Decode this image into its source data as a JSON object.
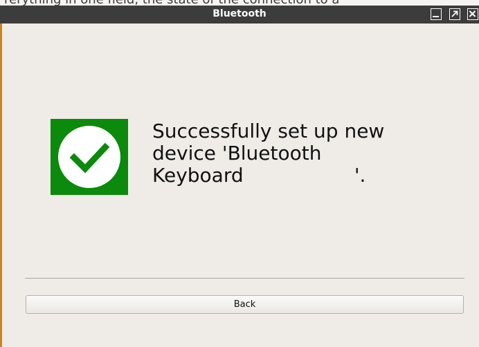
{
  "background_text": "rerything in one field, the state of the connection to a",
  "window": {
    "title": "Bluetooth",
    "controls": {
      "minimize_icon": "minimize-icon",
      "maximize_icon": "maximize-icon",
      "close_icon": "close-icon"
    }
  },
  "status": {
    "icon": "checkmark-icon",
    "icon_color": "#0b8a0b",
    "message": "Successfully set up new\ndevice 'Bluetooth\nKeyboard                  '."
  },
  "buttons": {
    "back_label": "Back"
  }
}
